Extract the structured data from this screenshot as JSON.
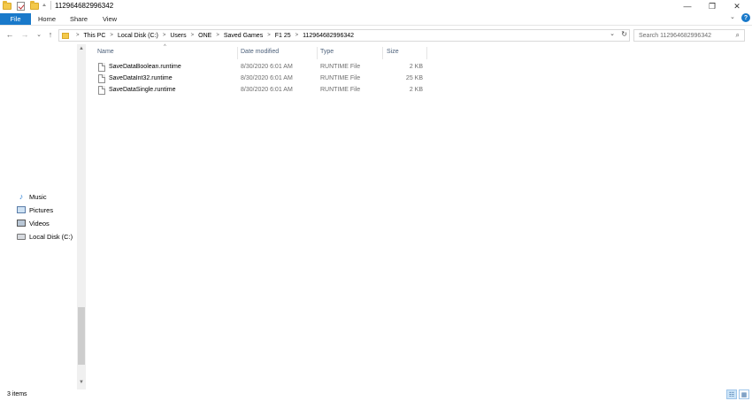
{
  "window": {
    "title": "112964682996342",
    "minimize_glyph": "—",
    "maximize_glyph": "❐",
    "close_glyph": "✕"
  },
  "ribbon": {
    "tabs": [
      "File",
      "Home",
      "Share",
      "View"
    ],
    "help_glyph": "?",
    "collapse_glyph": "⌄"
  },
  "nav": {
    "back_glyph": "←",
    "forward_glyph": "→",
    "recent_glyph": "⌄",
    "up_glyph": "↑"
  },
  "address": {
    "breadcrumbs": [
      "This PC",
      "Local Disk (C:)",
      "Users",
      "ONE",
      "Saved Games",
      "F1 25",
      "112964682996342"
    ],
    "separator": ">",
    "dropdown_glyph": "⌄",
    "refresh_glyph": "↻"
  },
  "search": {
    "placeholder": "Search 112964682996342",
    "icon": "⌕"
  },
  "sidebar": {
    "items": [
      {
        "label": "Music",
        "icon": "music-icon"
      },
      {
        "label": "Pictures",
        "icon": "pictures-icon"
      },
      {
        "label": "Videos",
        "icon": "videos-icon"
      },
      {
        "label": "Local Disk (C:)",
        "icon": "disk-icon"
      }
    ]
  },
  "columns": {
    "name": "Name",
    "date": "Date modified",
    "type": "Type",
    "size": "Size",
    "sort_glyph": "^"
  },
  "files": [
    {
      "name": "SaveDataBoolean.runtime",
      "date": "8/30/2020 6:01 AM",
      "type": "RUNTIME File",
      "size": "2 KB"
    },
    {
      "name": "SaveDataInt32.runtime",
      "date": "8/30/2020 6:01 AM",
      "type": "RUNTIME File",
      "size": "25 KB"
    },
    {
      "name": "SaveDataSingle.runtime",
      "date": "8/30/2020 6:01 AM",
      "type": "RUNTIME File",
      "size": "2 KB"
    }
  ],
  "status": {
    "item_count": "3 items"
  },
  "colors": {
    "accent": "#1979ca",
    "folder": "#f3c94b",
    "header_text": "#4c607a"
  }
}
